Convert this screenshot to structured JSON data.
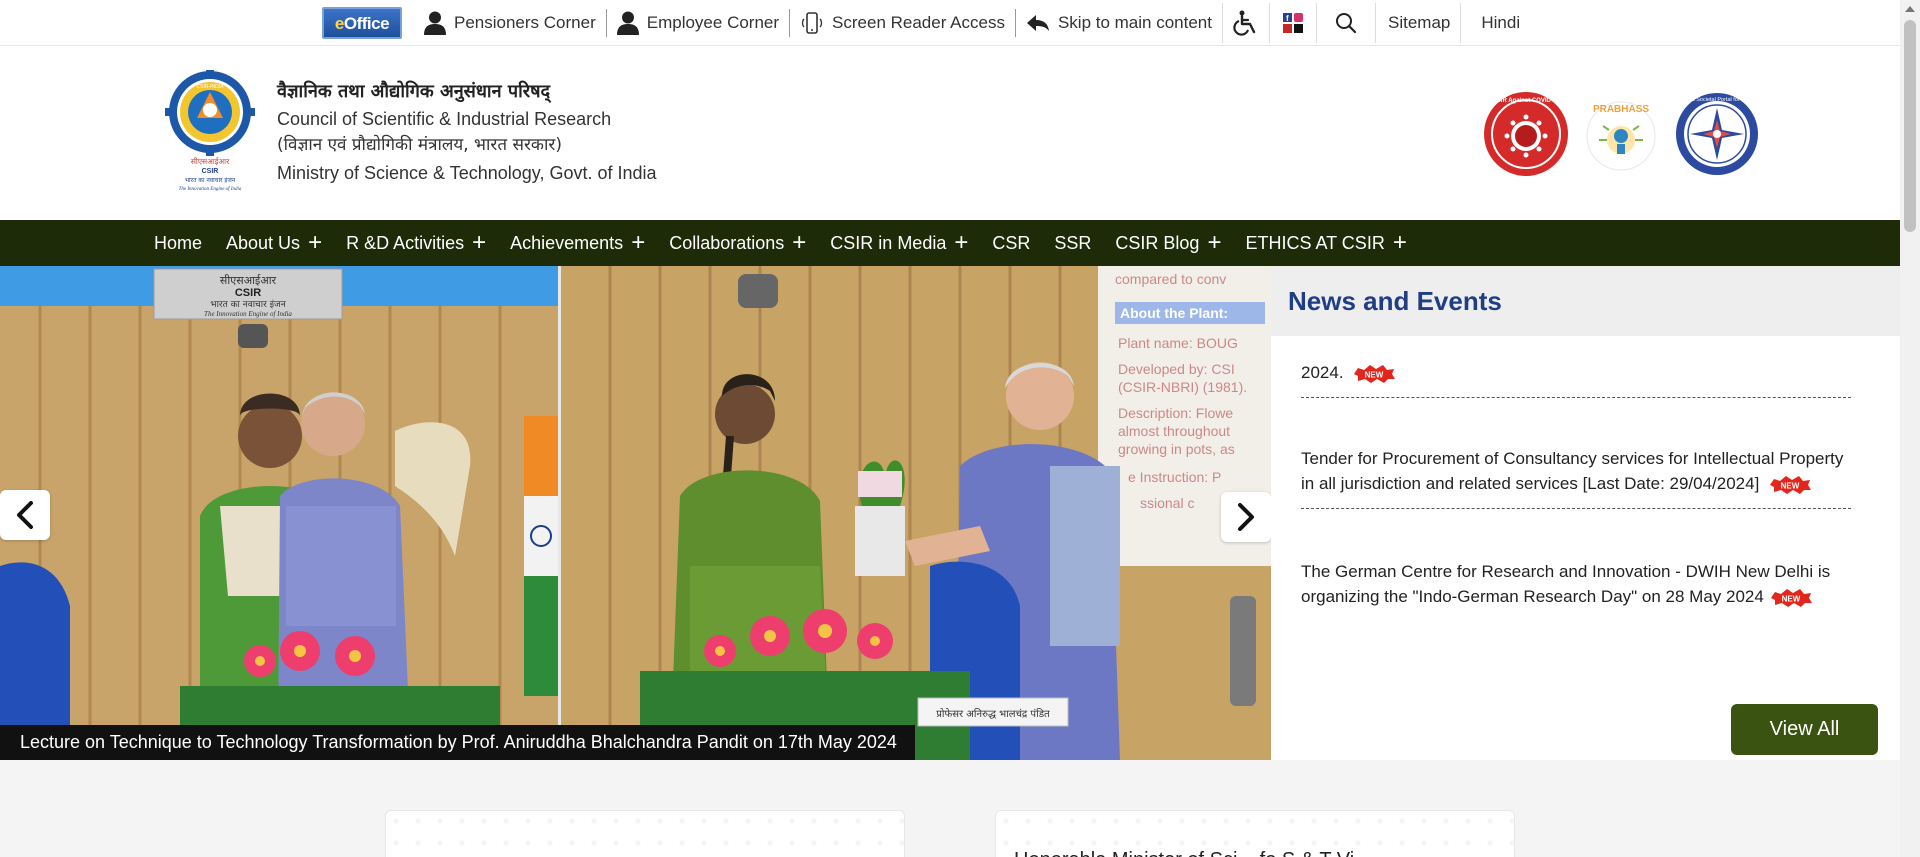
{
  "topbar": {
    "eoffice_logo": "eOffice",
    "links": [
      {
        "label": "Pensioners Corner",
        "icon": "user-icon"
      },
      {
        "label": "Employee Corner",
        "icon": "user-icon"
      },
      {
        "label": "Screen Reader Access",
        "icon": "mobile-speaker-icon"
      },
      {
        "label": "Skip to main content",
        "icon": "reply-arrow-icon"
      }
    ],
    "accessibility_icon": "wheelchair-icon",
    "social_icon": "social-media-icon",
    "search_icon": "search-icon",
    "sitemap": "Sitemap",
    "language": "Hindi"
  },
  "header": {
    "title_hindi": "वैज्ञानिक तथा औद्योगिक अनुसंधान परिषद्",
    "title_english": "Council of Scientific & Industrial Research",
    "subtitle_hindi": "(विज्ञान एवं प्रौद्योगिकी मंत्रालय, भारत सरकार)",
    "ministry": "Ministry of Science & Technology, Govt. of India",
    "logo_text": {
      "hindi": "सीएसआईआर",
      "english": "CSIR",
      "tag_hindi": "भारत का नवाचार इंजन",
      "tag": "The Innovation Engine of India",
      "ring": "CSIR-INDIA"
    },
    "badges": [
      {
        "name": "covid-badge",
        "text": "CSIR Against COVID-19",
        "color": "#d42a2a"
      },
      {
        "name": "prabhass-badge",
        "text": "PRABHASS",
        "color": "#f0a23a"
      },
      {
        "name": "portal-badge",
        "text": "CSIR's Societal Portal for Public",
        "color": "#2b4aa0"
      }
    ]
  },
  "nav": {
    "items": [
      {
        "label": "Home",
        "plus": false
      },
      {
        "label": "About Us",
        "plus": true
      },
      {
        "label": "R &D Activities",
        "plus": true
      },
      {
        "label": "Achievements",
        "plus": true
      },
      {
        "label": "Collaborations",
        "plus": true
      },
      {
        "label": "CSIR in Media",
        "plus": true
      },
      {
        "label": "CSR",
        "plus": false
      },
      {
        "label": "SSR",
        "plus": false
      },
      {
        "label": "CSIR Blog",
        "plus": true
      },
      {
        "label": "ETHICS AT CSIR",
        "plus": true
      }
    ],
    "plus_symbol": "+"
  },
  "slider": {
    "caption": "Lecture on Technique to Technology Transformation by Prof. Aniruddha Bhalchandra Pandit on 17th May 2024",
    "prev_icon": "chevron-left-icon",
    "next_icon": "chevron-right-icon",
    "photo_text": {
      "sign_hindi": "सीएसआईआर",
      "sign_english": "CSIR",
      "sign_hindi_2": "भारत का नवाचार इंजन",
      "sign_tagline": "The Innovation Engine of India",
      "screen_lines": [
        "compared to conv",
        "About the Plant:",
        "Plant name: BOUG",
        "Developed by: CSI",
        "(CSIR-NBRI) (1981).",
        "Description: Flowe",
        "almost throughout",
        "growing in pots, as",
        "e Instruction: P",
        "ssional c"
      ],
      "nameplate": "प्रोफेसर अनिरुद्ध भालचंद्र पंडित"
    }
  },
  "news": {
    "title": "News and Events",
    "new_tag": "NEW",
    "items": [
      {
        "text": "2024."
      },
      {
        "text": "Tender for Procurement of Consultancy services for Intellectual Property in all jurisdiction and related services [Last Date: 29/04/2024]"
      },
      {
        "text": "The German Centre for Research and Innovation - DWIH New Delhi is organizing the \"Indo-German Research Day\" on 28 May 2024"
      }
    ],
    "view_all": "View All"
  },
  "cards": [
    {
      "title": ""
    },
    {
      "title": "Honorable Minister of Sci... fo S & T Vi..."
    }
  ]
}
